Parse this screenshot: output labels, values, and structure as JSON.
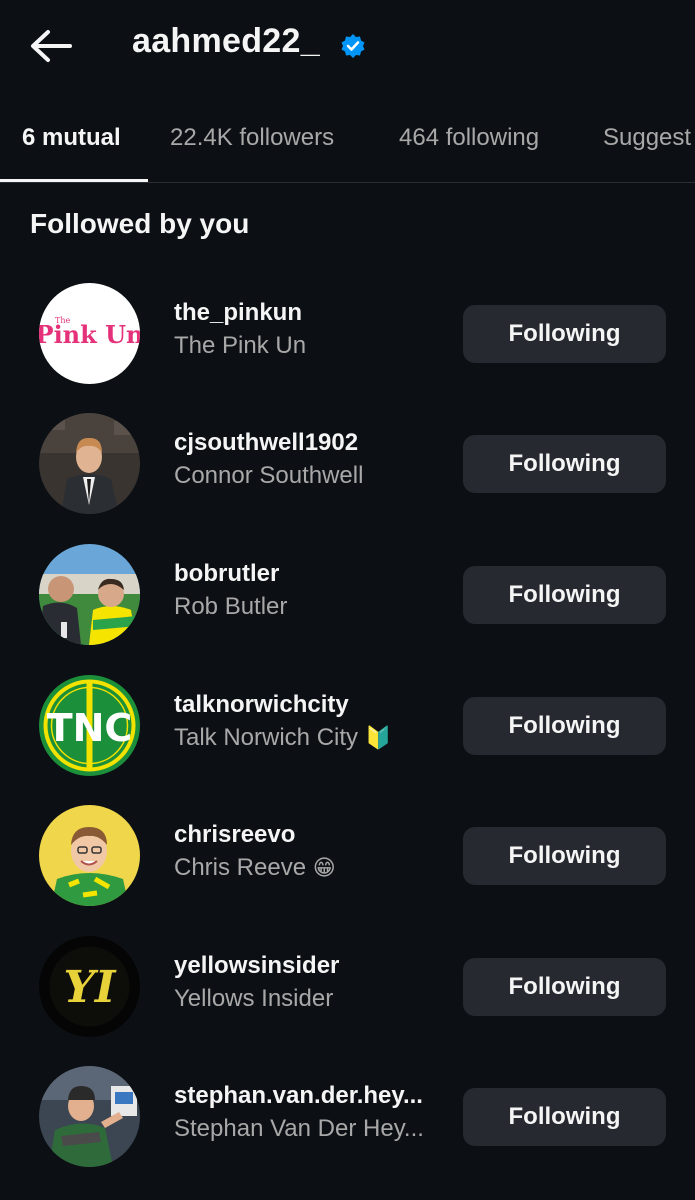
{
  "header": {
    "title": "aahmed22_"
  },
  "tabs": [
    {
      "label": "6 mutual"
    },
    {
      "label": "22.4K followers"
    },
    {
      "label": "464 following"
    },
    {
      "label": "Suggest"
    }
  ],
  "section_title": "Followed by you",
  "button_label": "Following",
  "users": [
    {
      "username": "the_pinkun",
      "display_name": "The Pink Un",
      "avatar_logo_text": "Pink Un",
      "avatar_logo_small": "The"
    },
    {
      "username": "cjsouthwell1902",
      "display_name": "Connor Southwell"
    },
    {
      "username": "bobrutler",
      "display_name": "Rob Butler"
    },
    {
      "username": "talknorwichcity",
      "display_name": "Talk Norwich City",
      "avatar_logo_text": "TNC",
      "badge": "🔰"
    },
    {
      "username": "chrisreevo",
      "display_name": "Chris Reeve",
      "badge": "😁"
    },
    {
      "username": "yellowsinsider",
      "display_name": "Yellows Insider",
      "avatar_logo_text": "YI"
    },
    {
      "username": "stephan.van.der.hey...",
      "display_name": "Stephan Van Der Hey..."
    }
  ],
  "colors": {
    "background": "#0c1014",
    "button_bg": "#262a30",
    "secondary_text": "#a8a8a8",
    "verified_blue": "#0095f6",
    "pink": "#e4317a",
    "tnc_green": "#1b8f3a",
    "yellow": "#f2e200"
  }
}
